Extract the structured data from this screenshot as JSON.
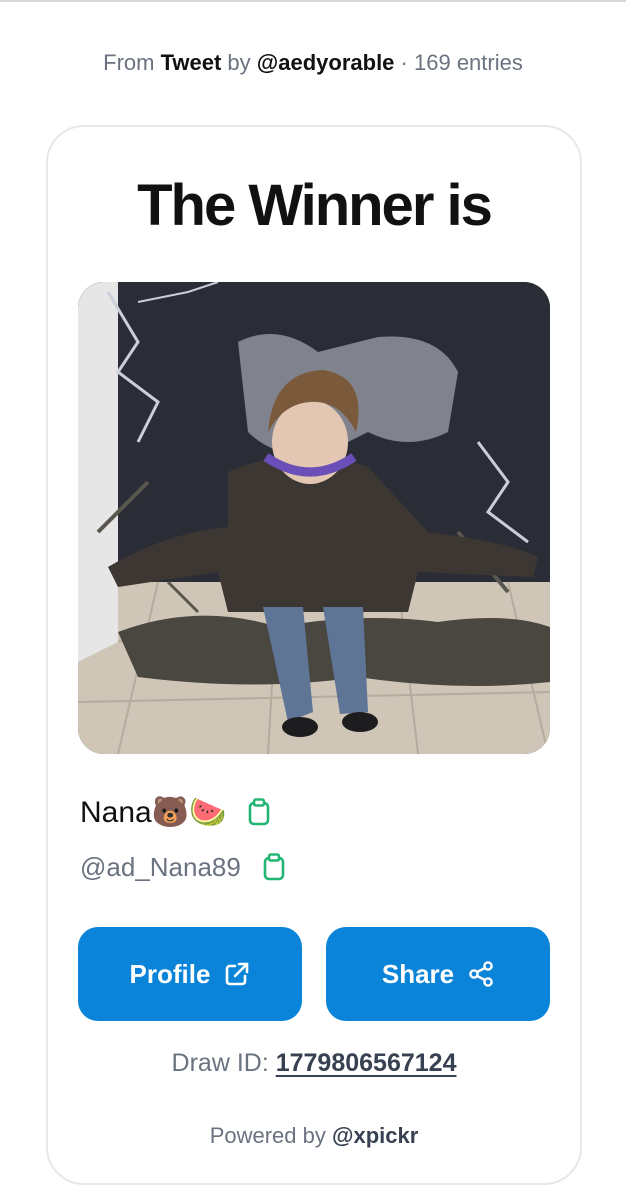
{
  "source": {
    "from_label": "From",
    "platform": "Tweet",
    "by_label": "by",
    "author": "@aedyorable",
    "separator": "·",
    "entries": "169 entries"
  },
  "card": {
    "title": "The Winner is",
    "winner": {
      "display_name": "Nana🐻🍉",
      "handle": "@ad_Nana89",
      "copy_icon": "clipboard-icon"
    },
    "buttons": {
      "profile_label": "Profile",
      "profile_icon": "external-link-icon",
      "share_label": "Share",
      "share_icon": "share-icon"
    },
    "draw": {
      "label": "Draw ID:",
      "id": "1779806567124"
    },
    "footer": {
      "powered_label": "Powered by",
      "brand": "@xpickr"
    }
  },
  "colors": {
    "accent": "#0a84d8",
    "copy_icon": "#22b573",
    "muted_text": "#6b7280"
  }
}
